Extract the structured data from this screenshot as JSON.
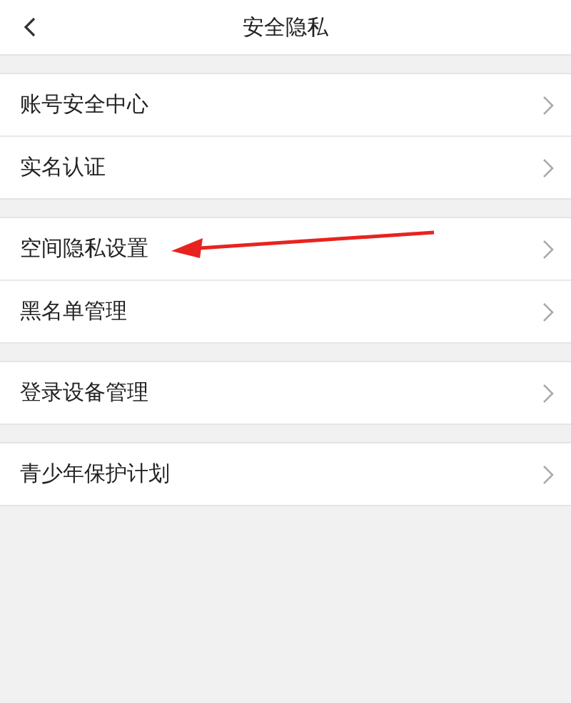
{
  "header": {
    "title": "安全隐私"
  },
  "groups": [
    {
      "items": [
        {
          "label": "账号安全中心",
          "pointed": false
        },
        {
          "label": "实名认证",
          "pointed": false
        }
      ]
    },
    {
      "items": [
        {
          "label": "空间隐私设置",
          "pointed": true
        },
        {
          "label": "黑名单管理",
          "pointed": false
        }
      ]
    },
    {
      "items": [
        {
          "label": "登录设备管理",
          "pointed": false
        }
      ]
    },
    {
      "items": [
        {
          "label": "青少年保护计划",
          "pointed": false
        }
      ]
    }
  ]
}
